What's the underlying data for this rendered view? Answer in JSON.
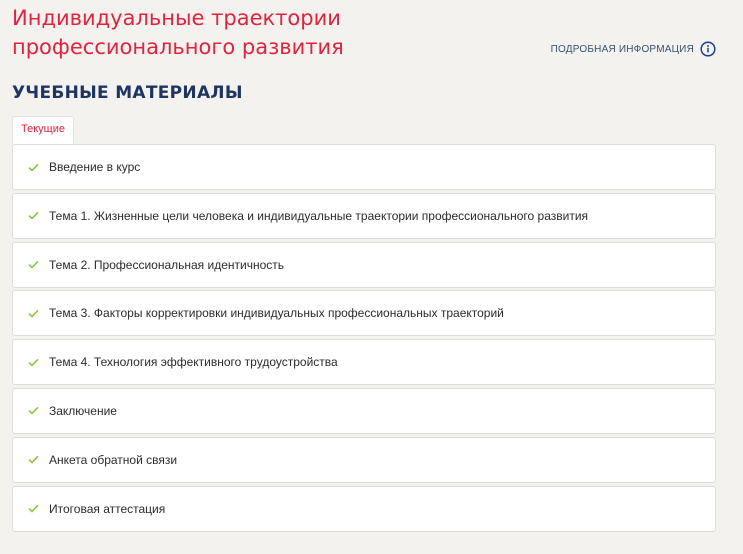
{
  "header": {
    "title": "Индивидуальные траектории профессионального развития",
    "more_info_label": "ПОДРОБНАЯ ИНФОРМАЦИЯ",
    "more_info_icon": "info-icon"
  },
  "materials": {
    "section_title": "УЧЕБНЫЕ МАТЕРИАЛЫ",
    "tabs": [
      {
        "label": "Текущие",
        "active": true
      }
    ],
    "items": [
      {
        "label": "Введение в курс",
        "completed": true
      },
      {
        "label": "Тема 1. Жизненные цели человека и индивидуальные траектории профессионального развития",
        "completed": true
      },
      {
        "label": "Тема 2. Профессиональная идентичность",
        "completed": true
      },
      {
        "label": "Тема 3. Факторы корректировки индивидуальных профессиональных траекторий",
        "completed": true
      },
      {
        "label": "Тема 4. Технология эффективного трудоустройства",
        "completed": true
      },
      {
        "label": "Заключение",
        "completed": true
      },
      {
        "label": "Анкета обратной связи",
        "completed": true
      },
      {
        "label": "Итоговая аттестация",
        "completed": true
      }
    ]
  },
  "colors": {
    "title": "#e0243f",
    "section_title": "#1f3460",
    "check": "#8cc63f",
    "background": "#f3f2ef"
  }
}
